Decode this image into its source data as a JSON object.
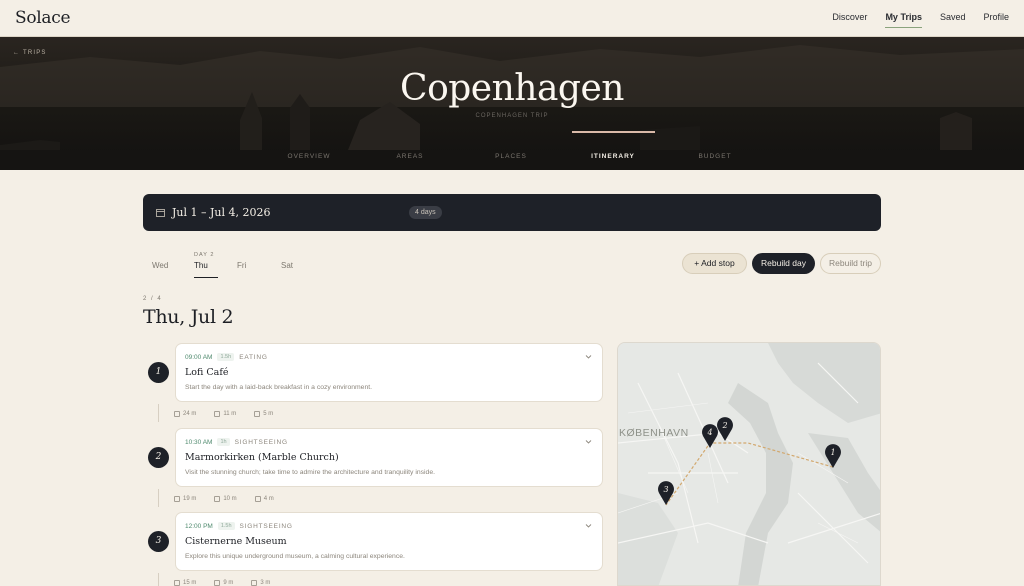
{
  "app": {
    "logo": "Solace"
  },
  "nav": {
    "items": [
      "Discover",
      "My Trips",
      "Saved",
      "Profile"
    ],
    "active": "My Trips"
  },
  "hero": {
    "back_label": "TRIPS",
    "title": "Copenhagen",
    "subtitle": "COPENHAGEN TRIP",
    "tabs": [
      "OVERVIEW",
      "AREAS",
      "PLACES",
      "ITINERARY",
      "BUDGET"
    ],
    "active_tab": "ITINERARY"
  },
  "datebar": {
    "range": "Jul 1 – Jul 4, 2026",
    "duration_badge": "4 days"
  },
  "days": {
    "tabs": [
      "Wed",
      "Thu",
      "Fri",
      "Sat"
    ],
    "active": "Thu",
    "active_kicker": "DAY 2"
  },
  "actions": {
    "add_stop": "+ Add stop",
    "rebuild_day": "Rebuild day",
    "rebuild_trip": "Rebuild trip"
  },
  "day": {
    "counter": "2 / 4",
    "heading": "Thu, Jul 2"
  },
  "stops": [
    {
      "number": "1",
      "time": "09:00 AM",
      "duration": "1.5h",
      "category": "EATING",
      "name": "Lofi Café",
      "description": "Start the day with a laid-back breakfast in a cozy environment.",
      "travel": {
        "walk": "24 m",
        "transit": "11 m",
        "car": "5 m"
      }
    },
    {
      "number": "2",
      "time": "10:30 AM",
      "duration": "1h",
      "category": "SIGHTSEEING",
      "name": "Marmorkirken (Marble Church)",
      "description": "Visit the stunning church; take time to admire the architecture and tranquility inside.",
      "travel": {
        "walk": "19 m",
        "transit": "10 m",
        "car": "4 m"
      }
    },
    {
      "number": "3",
      "time": "12:00 PM",
      "duration": "1.5h",
      "category": "SIGHTSEEING",
      "name": "Cisternerne Museum",
      "description": "Explore this unique underground museum, a calming cultural experience.",
      "travel": {
        "walk": "15 m",
        "transit": "9 m",
        "car": "3 m"
      }
    }
  ],
  "map": {
    "label": "KØBENHAVN",
    "pins": [
      "1",
      "2",
      "3",
      "4"
    ]
  }
}
